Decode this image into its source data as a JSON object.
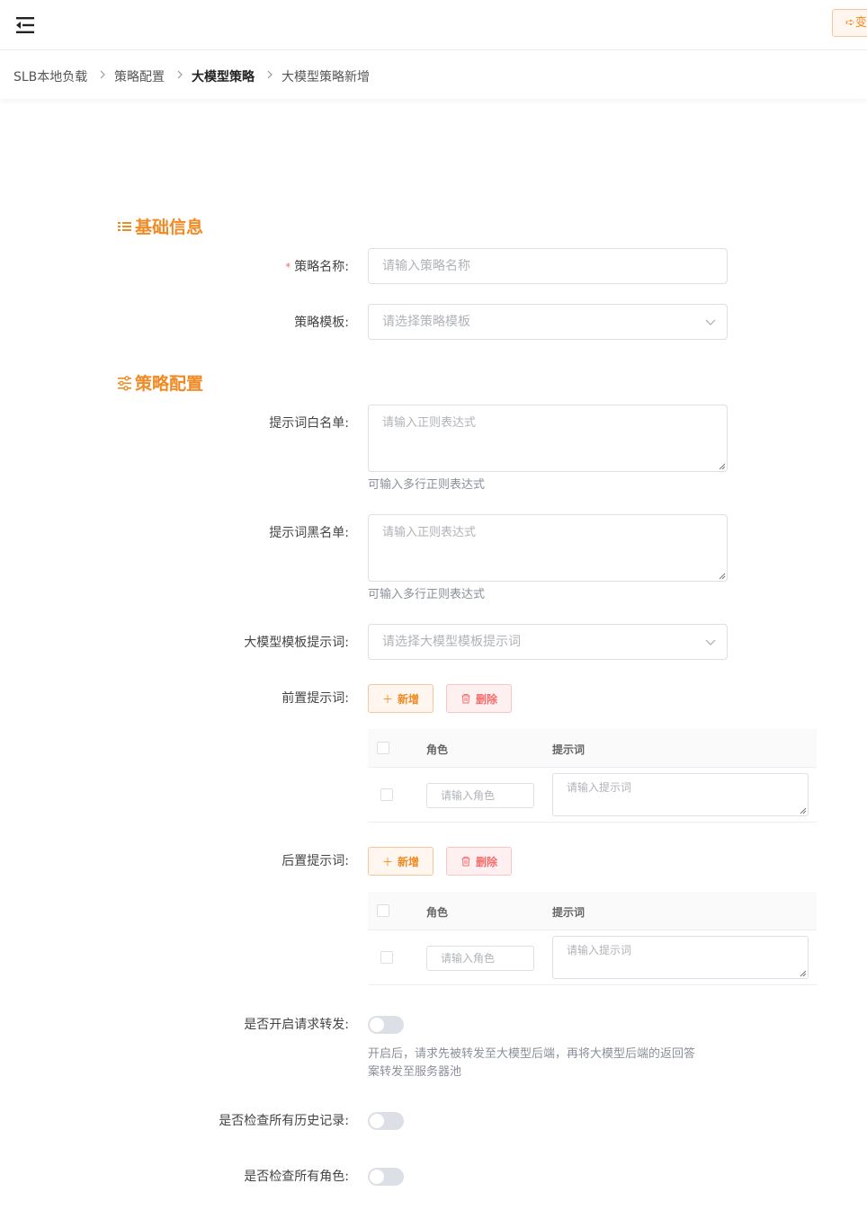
{
  "header": {
    "menu_icon": "menu-fold-icon",
    "action_label": "➪变"
  },
  "breadcrumb": [
    "SLB本地负载",
    "策略配置",
    "大模型策略",
    "大模型策略新增"
  ],
  "sections": {
    "basic": {
      "title": "基础信息",
      "icon": "list-icon"
    },
    "strategy": {
      "title": "策略配置",
      "icon": "sliders-icon"
    }
  },
  "form": {
    "name": {
      "required_mark": "*",
      "label": "策略名称:",
      "placeholder": "请输入策略名称"
    },
    "template": {
      "label": "策略模板:",
      "placeholder": "请选择策略模板"
    },
    "whitelist": {
      "label": "提示词白名单:",
      "placeholder": "请输入正则表达式",
      "hint": "可输入多行正则表达式"
    },
    "blacklist": {
      "label": "提示词黑名单:",
      "placeholder": "请输入正则表达式",
      "hint": "可输入多行正则表达式"
    },
    "llm_template": {
      "label": "大模型模板提示词:",
      "placeholder": "请选择大模型模板提示词"
    },
    "pre_prompt": {
      "label": "前置提示词:",
      "add_label": "新增",
      "delete_label": "删除",
      "col_role": "角色",
      "col_prompt": "提示词",
      "role_placeholder": "请输入角色",
      "prompt_placeholder": "请输入提示词"
    },
    "post_prompt": {
      "label": "后置提示词:",
      "add_label": "新增",
      "delete_label": "删除",
      "col_role": "角色",
      "col_prompt": "提示词",
      "role_placeholder": "请输入角色",
      "prompt_placeholder": "请输入提示词"
    },
    "forward": {
      "label": "是否开启请求转发:",
      "enabled": false,
      "hint_line1": "开启后，请求先被转发至大模型后端，再将大模型后端的返回答",
      "hint_line2": "案转发至服务器池"
    },
    "check_history": {
      "label": "是否检查所有历史记录:",
      "enabled": false
    },
    "check_roles": {
      "label": "是否检查所有角色:",
      "enabled": false
    }
  },
  "colors": {
    "accent": "#f08a24",
    "danger": "#f56c6c",
    "border": "#dcdfe6"
  }
}
